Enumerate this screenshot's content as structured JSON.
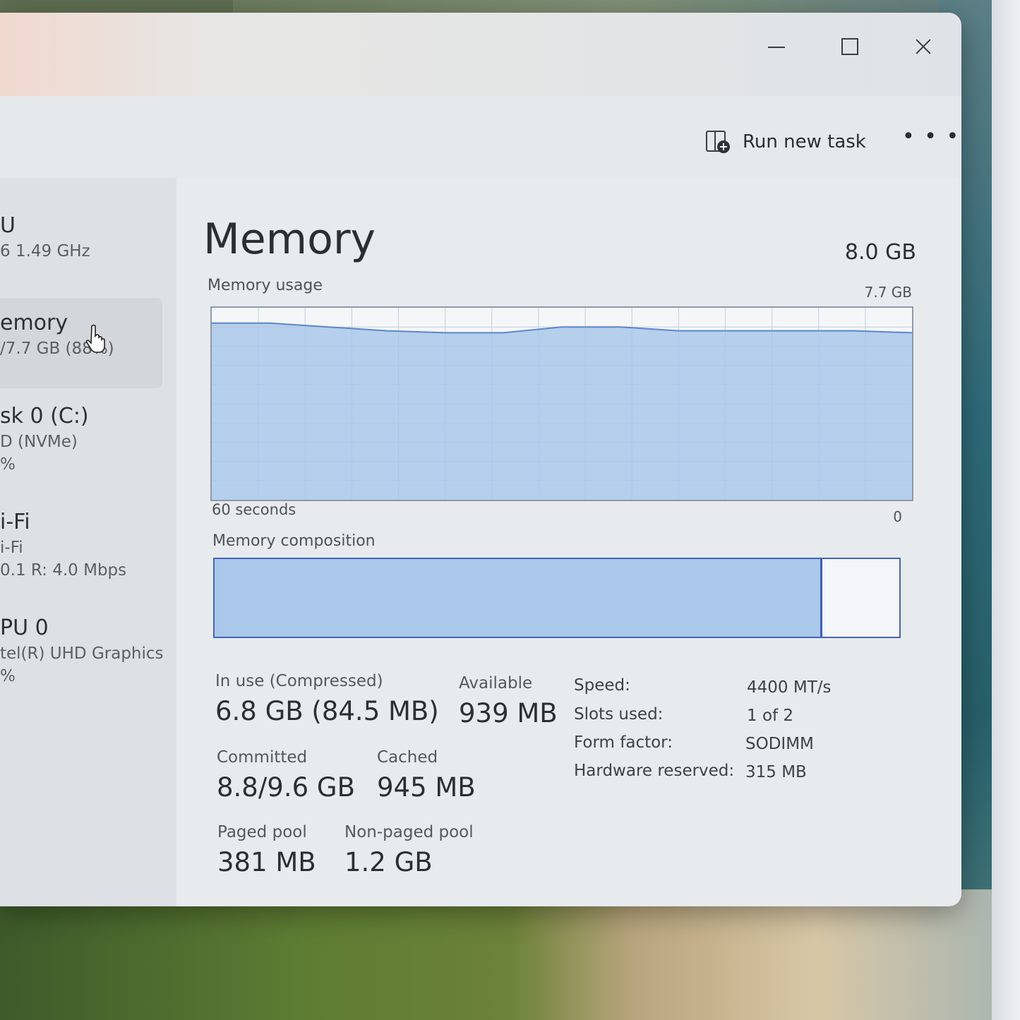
{
  "window": {
    "controls": {
      "minimize": "minimize",
      "maximize": "maximize",
      "close": "close"
    }
  },
  "toolbar": {
    "run_new_task": "Run new task",
    "more": "• • •"
  },
  "sidebar": {
    "items": [
      {
        "title": "U",
        "subtitle": "6 1.49 GHz",
        "extra": ""
      },
      {
        "title": "emory",
        "subtitle": "/7.7 GB (88%)",
        "extra": ""
      },
      {
        "title": "sk 0 (C:)",
        "subtitle": "D (NVMe)",
        "extra": "%"
      },
      {
        "title": "i-Fi",
        "subtitle": "i-Fi",
        "extra": "0.1 R: 4.0 Mbps"
      },
      {
        "title": "PU 0",
        "subtitle": "tel(R) UHD Graphics",
        "extra": "%"
      }
    ]
  },
  "main": {
    "title": "Memory",
    "total": "8.0 GB",
    "usage_label": "Memory usage",
    "usage_max": "7.7 GB",
    "axis_left": "60 seconds",
    "axis_right": "0",
    "composition_label": "Memory composition",
    "composition_fill": 0.885,
    "stats": {
      "in_use_label": "In use (Compressed)",
      "in_use_value": "6.8 GB (84.5 MB)",
      "available_label": "Available",
      "available_value": "939 MB",
      "committed_label": "Committed",
      "committed_value": "8.8/9.6 GB",
      "cached_label": "Cached",
      "cached_value": "945 MB",
      "paged_label": "Paged pool",
      "paged_value": "381 MB",
      "nonpaged_label": "Non-paged pool",
      "nonpaged_value": "1.2 GB"
    },
    "specs": {
      "speed_label": "Speed:",
      "speed_value": "4400 MT/s",
      "slots_label": "Slots used:",
      "slots_value": "1 of 2",
      "form_label": "Form factor:",
      "form_value": "SODIMM",
      "hw_label": "Hardware reserved:",
      "hw_value": "315 MB"
    }
  },
  "chart_data": {
    "type": "area",
    "x": [
      60,
      55,
      50,
      45,
      40,
      35,
      30,
      25,
      20,
      15,
      10,
      5,
      0
    ],
    "values": [
      92,
      92,
      90,
      88,
      87,
      87,
      90,
      90,
      88,
      88,
      88,
      88,
      87
    ],
    "ylim": [
      0,
      100
    ],
    "xlabel": "60 seconds",
    "ylabel": "Memory usage",
    "grid": true,
    "colors": {
      "fill": "#a9c8ea",
      "line": "#5b86c9",
      "grid": "#c4cfdc"
    }
  }
}
